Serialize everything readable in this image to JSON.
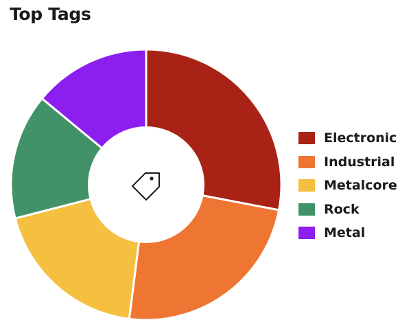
{
  "card": {
    "title": "Top Tags",
    "center_icon": "tag-icon"
  },
  "chart_data": {
    "type": "pie",
    "donut": true,
    "title": "Top Tags",
    "legend_position": "right",
    "categories": [
      "Electronic",
      "Industrial",
      "Metalcore",
      "Rock",
      "Metal"
    ],
    "values": [
      28,
      24,
      19,
      15,
      14
    ],
    "colors": [
      "#a92216",
      "#ee7532",
      "#f5bf40",
      "#419367",
      "#8c1eef"
    ]
  }
}
